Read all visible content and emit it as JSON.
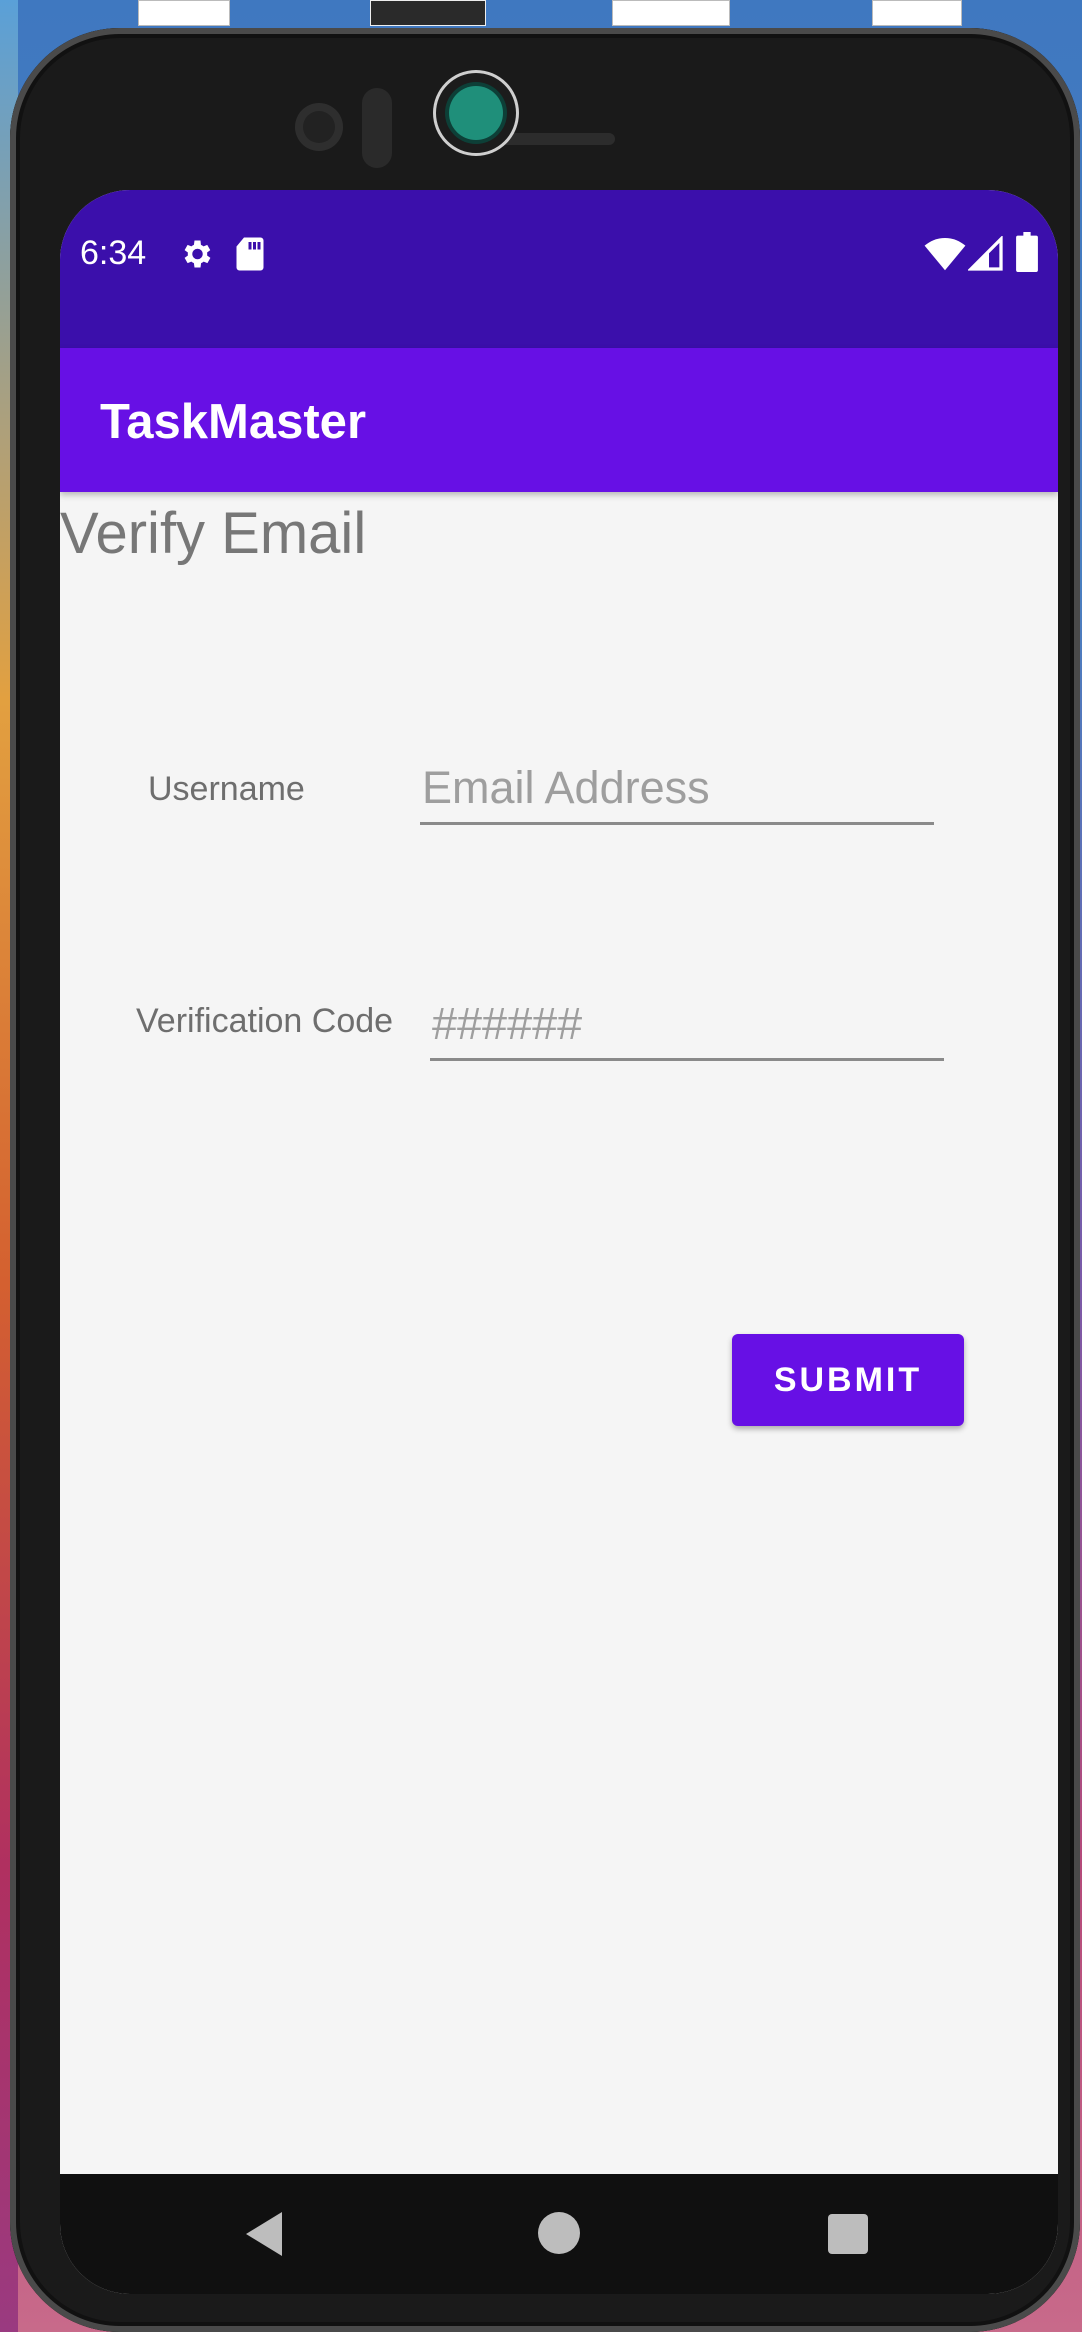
{
  "status_bar": {
    "time": "6:34",
    "icons_left": [
      "gear-icon",
      "sd-card-icon"
    ],
    "icons_right": [
      "wifi-icon",
      "signal-icon",
      "battery-icon"
    ]
  },
  "app_bar": {
    "title": "TaskMaster"
  },
  "page": {
    "heading": "Verify Email",
    "username_label": "Username",
    "username_placeholder": "Email Address",
    "code_label": "Verification Code",
    "code_placeholder": "######",
    "submit_label": "SUBMIT"
  },
  "navigation": {
    "buttons": [
      "back-icon",
      "home-icon",
      "recents-icon"
    ]
  },
  "colors": {
    "status_bar": "#3b0fab",
    "app_bar": "#6710e5",
    "accent": "#6710e5",
    "background": "#f5f5f5"
  }
}
